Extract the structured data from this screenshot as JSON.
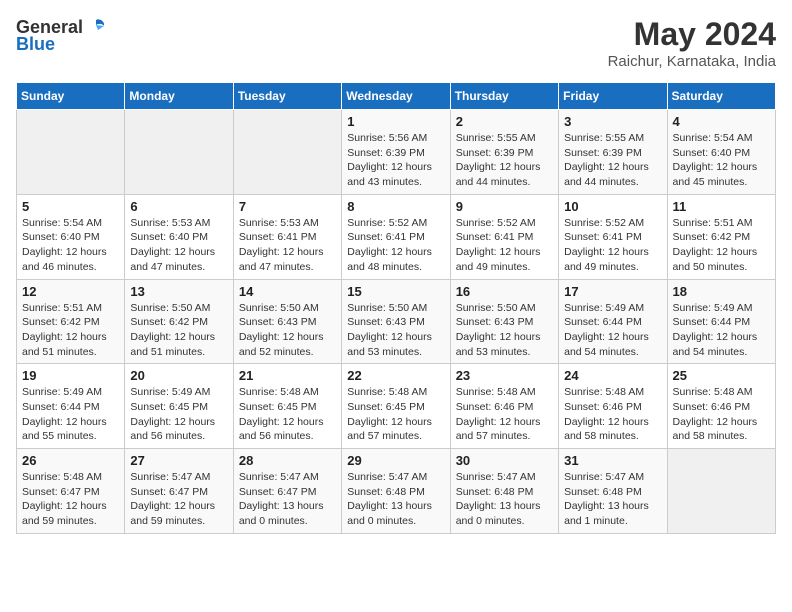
{
  "logo": {
    "text_general": "General",
    "text_blue": "Blue"
  },
  "title": "May 2024",
  "subtitle": "Raichur, Karnataka, India",
  "days_of_week": [
    "Sunday",
    "Monday",
    "Tuesday",
    "Wednesday",
    "Thursday",
    "Friday",
    "Saturday"
  ],
  "weeks": [
    [
      {
        "day": "",
        "info": ""
      },
      {
        "day": "",
        "info": ""
      },
      {
        "day": "",
        "info": ""
      },
      {
        "day": "1",
        "info": "Sunrise: 5:56 AM\nSunset: 6:39 PM\nDaylight: 12 hours\nand 43 minutes."
      },
      {
        "day": "2",
        "info": "Sunrise: 5:55 AM\nSunset: 6:39 PM\nDaylight: 12 hours\nand 44 minutes."
      },
      {
        "day": "3",
        "info": "Sunrise: 5:55 AM\nSunset: 6:39 PM\nDaylight: 12 hours\nand 44 minutes."
      },
      {
        "day": "4",
        "info": "Sunrise: 5:54 AM\nSunset: 6:40 PM\nDaylight: 12 hours\nand 45 minutes."
      }
    ],
    [
      {
        "day": "5",
        "info": "Sunrise: 5:54 AM\nSunset: 6:40 PM\nDaylight: 12 hours\nand 46 minutes."
      },
      {
        "day": "6",
        "info": "Sunrise: 5:53 AM\nSunset: 6:40 PM\nDaylight: 12 hours\nand 47 minutes."
      },
      {
        "day": "7",
        "info": "Sunrise: 5:53 AM\nSunset: 6:41 PM\nDaylight: 12 hours\nand 47 minutes."
      },
      {
        "day": "8",
        "info": "Sunrise: 5:52 AM\nSunset: 6:41 PM\nDaylight: 12 hours\nand 48 minutes."
      },
      {
        "day": "9",
        "info": "Sunrise: 5:52 AM\nSunset: 6:41 PM\nDaylight: 12 hours\nand 49 minutes."
      },
      {
        "day": "10",
        "info": "Sunrise: 5:52 AM\nSunset: 6:41 PM\nDaylight: 12 hours\nand 49 minutes."
      },
      {
        "day": "11",
        "info": "Sunrise: 5:51 AM\nSunset: 6:42 PM\nDaylight: 12 hours\nand 50 minutes."
      }
    ],
    [
      {
        "day": "12",
        "info": "Sunrise: 5:51 AM\nSunset: 6:42 PM\nDaylight: 12 hours\nand 51 minutes."
      },
      {
        "day": "13",
        "info": "Sunrise: 5:50 AM\nSunset: 6:42 PM\nDaylight: 12 hours\nand 51 minutes."
      },
      {
        "day": "14",
        "info": "Sunrise: 5:50 AM\nSunset: 6:43 PM\nDaylight: 12 hours\nand 52 minutes."
      },
      {
        "day": "15",
        "info": "Sunrise: 5:50 AM\nSunset: 6:43 PM\nDaylight: 12 hours\nand 53 minutes."
      },
      {
        "day": "16",
        "info": "Sunrise: 5:50 AM\nSunset: 6:43 PM\nDaylight: 12 hours\nand 53 minutes."
      },
      {
        "day": "17",
        "info": "Sunrise: 5:49 AM\nSunset: 6:44 PM\nDaylight: 12 hours\nand 54 minutes."
      },
      {
        "day": "18",
        "info": "Sunrise: 5:49 AM\nSunset: 6:44 PM\nDaylight: 12 hours\nand 54 minutes."
      }
    ],
    [
      {
        "day": "19",
        "info": "Sunrise: 5:49 AM\nSunset: 6:44 PM\nDaylight: 12 hours\nand 55 minutes."
      },
      {
        "day": "20",
        "info": "Sunrise: 5:49 AM\nSunset: 6:45 PM\nDaylight: 12 hours\nand 56 minutes."
      },
      {
        "day": "21",
        "info": "Sunrise: 5:48 AM\nSunset: 6:45 PM\nDaylight: 12 hours\nand 56 minutes."
      },
      {
        "day": "22",
        "info": "Sunrise: 5:48 AM\nSunset: 6:45 PM\nDaylight: 12 hours\nand 57 minutes."
      },
      {
        "day": "23",
        "info": "Sunrise: 5:48 AM\nSunset: 6:46 PM\nDaylight: 12 hours\nand 57 minutes."
      },
      {
        "day": "24",
        "info": "Sunrise: 5:48 AM\nSunset: 6:46 PM\nDaylight: 12 hours\nand 58 minutes."
      },
      {
        "day": "25",
        "info": "Sunrise: 5:48 AM\nSunset: 6:46 PM\nDaylight: 12 hours\nand 58 minutes."
      }
    ],
    [
      {
        "day": "26",
        "info": "Sunrise: 5:48 AM\nSunset: 6:47 PM\nDaylight: 12 hours\nand 59 minutes."
      },
      {
        "day": "27",
        "info": "Sunrise: 5:47 AM\nSunset: 6:47 PM\nDaylight: 12 hours\nand 59 minutes."
      },
      {
        "day": "28",
        "info": "Sunrise: 5:47 AM\nSunset: 6:47 PM\nDaylight: 13 hours\nand 0 minutes."
      },
      {
        "day": "29",
        "info": "Sunrise: 5:47 AM\nSunset: 6:48 PM\nDaylight: 13 hours\nand 0 minutes."
      },
      {
        "day": "30",
        "info": "Sunrise: 5:47 AM\nSunset: 6:48 PM\nDaylight: 13 hours\nand 0 minutes."
      },
      {
        "day": "31",
        "info": "Sunrise: 5:47 AM\nSunset: 6:48 PM\nDaylight: 13 hours\nand 1 minute."
      },
      {
        "day": "",
        "info": ""
      }
    ]
  ]
}
